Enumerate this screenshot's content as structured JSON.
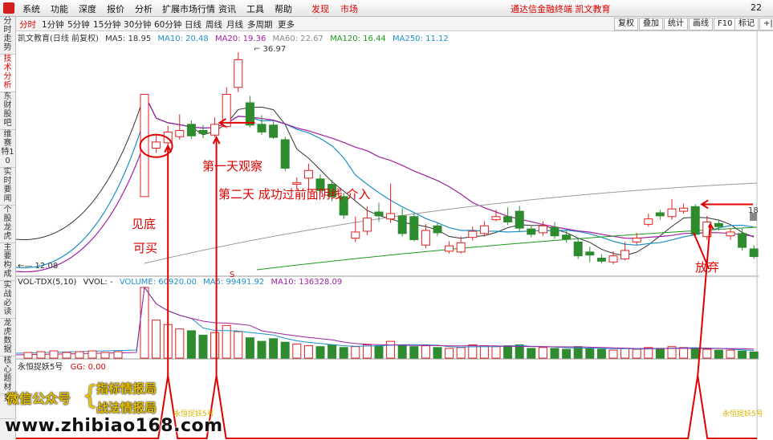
{
  "menu": {
    "items": [
      "系统",
      "功能",
      "深度",
      "报价",
      "分析",
      "扩展市场行情",
      "资讯",
      "工具",
      "帮助",
      "发现",
      "市场"
    ],
    "app_title": "通达信金融终端 凯文教育",
    "corner": "22"
  },
  "toolbar": {
    "periods": [
      "分时",
      "1分钟",
      "5分钟",
      "15分钟",
      "30分钟",
      "60分钟",
      "日线",
      "周线",
      "月线",
      "多周期",
      "更多"
    ],
    "buttons": [
      "复权",
      "叠加",
      "统计",
      "画线",
      "F10",
      "标记",
      "+|"
    ]
  },
  "sidebar": {
    "items": [
      "分时走势",
      "技术分析",
      "东财股吧",
      "维赛特10",
      "实时要闻",
      "个股龙虎",
      "主要构成",
      "实战必读",
      "龙虎数据",
      "核心题材",
      "第"
    ]
  },
  "price_legend": {
    "title": "凯文教育(日线 前复权)",
    "ma5": "MA5: 18.95",
    "ma10": "MA10: 20.48",
    "ma20": "MA20: 19.36",
    "ma60": "MA60: 22.67",
    "ma120": "MA120: 16.44",
    "ma250": "MA250: 11.12",
    "high_label": "36.97",
    "low_label": "12.08",
    "right_label": "18"
  },
  "volume_legend": {
    "name": "VOL-TDX(5,10)",
    "vvol": "VVOL: -",
    "volume": "VOLUME: 60920.00",
    "ma5": "MA5: 99491.92",
    "ma10": "MA10: 136328.09"
  },
  "indicator_legend": {
    "name": "永恒捉妖5号",
    "gg": "GG: 0.00",
    "tag": "永恒捉妖5号"
  },
  "annotations": {
    "a1": "见底",
    "a2": "可买",
    "a3": "第一天观察",
    "a4": "第二天 成功过前面阴线 介入",
    "a5": "放弃",
    "s_mark": "S"
  },
  "watermark": {
    "label": "微信公众号",
    "line1": "指标情报局",
    "line2": "战法情报局",
    "url": "www.zhibiao168.com"
  },
  "colors": {
    "up": "#e02020",
    "down": "#2e8b2e",
    "ma5": "#333333",
    "ma10": "#1e90c8",
    "ma20": "#a020a0",
    "ma60": "#888888",
    "ma120": "#1a9a1a",
    "ma250": "#e07020"
  },
  "chart_data": {
    "type": "candlestick",
    "candles": [
      {
        "o": 18.2,
        "c": 31.5,
        "h": 31.5,
        "l": 18.2,
        "v": 800
      },
      {
        "o": 24.5,
        "c": 25.3,
        "h": 26.4,
        "l": 23.9,
        "v": 430
      },
      {
        "o": 25.2,
        "c": 26.6,
        "h": 27.4,
        "l": 24.6,
        "v": 380
      },
      {
        "o": 26.0,
        "c": 26.8,
        "h": 28.9,
        "l": 25.6,
        "v": 330
      },
      {
        "o": 27.6,
        "c": 26.1,
        "h": 28.1,
        "l": 25.7,
        "v": 310
      },
      {
        "o": 26.8,
        "c": 26.4,
        "h": 27.5,
        "l": 25.8,
        "v": 260
      },
      {
        "o": 26.2,
        "c": 27.6,
        "h": 28.5,
        "l": 25.9,
        "v": 290
      },
      {
        "o": 27.3,
        "c": 31.5,
        "h": 32.4,
        "l": 27.1,
        "v": 370
      },
      {
        "o": 32.4,
        "c": 36.0,
        "h": 36.97,
        "l": 31.8,
        "v": 300
      },
      {
        "o": 30.4,
        "c": 27.5,
        "h": 31.3,
        "l": 27.2,
        "v": 230
      },
      {
        "o": 27.6,
        "c": 26.6,
        "h": 28.8,
        "l": 26.2,
        "v": 190
      },
      {
        "o": 27.5,
        "c": 25.9,
        "h": 28.0,
        "l": 25.7,
        "v": 220
      },
      {
        "o": 25.6,
        "c": 21.9,
        "h": 26.0,
        "l": 21.5,
        "v": 180
      },
      {
        "o": 19.8,
        "c": 20.0,
        "h": 20.7,
        "l": 19.1,
        "v": 160
      },
      {
        "o": 20.6,
        "c": 21.6,
        "h": 22.5,
        "l": 18.9,
        "v": 140
      },
      {
        "o": 20.5,
        "c": 19.0,
        "h": 21.1,
        "l": 18.6,
        "v": 130
      },
      {
        "o": 19.8,
        "c": 18.2,
        "h": 20.4,
        "l": 17.6,
        "v": 150
      },
      {
        "o": 18.2,
        "c": 15.8,
        "h": 18.7,
        "l": 15.3,
        "v": 120
      },
      {
        "o": 12.8,
        "c": 13.6,
        "h": 15.6,
        "l": 12.3,
        "v": 130
      },
      {
        "o": 13.7,
        "c": 15.4,
        "h": 16.9,
        "l": 13.2,
        "v": 150
      },
      {
        "o": 16.2,
        "c": 15.7,
        "h": 17.4,
        "l": 14.9,
        "v": 140
      },
      {
        "o": 15.3,
        "c": 16.0,
        "h": 19.9,
        "l": 14.8,
        "v": 190
      },
      {
        "o": 15.7,
        "c": 13.4,
        "h": 16.7,
        "l": 13.0,
        "v": 150
      },
      {
        "o": 15.6,
        "c": 12.6,
        "h": 16.0,
        "l": 12.4,
        "v": 130
      },
      {
        "o": 11.9,
        "c": 13.8,
        "h": 14.6,
        "l": 11.5,
        "v": 140
      },
      {
        "o": 14.4,
        "c": 13.5,
        "h": 14.8,
        "l": 13.1,
        "v": 120
      },
      {
        "o": 11.1,
        "c": 11.8,
        "h": 12.4,
        "l": 10.8,
        "v": 110
      },
      {
        "o": 11.0,
        "c": 12.2,
        "h": 13.0,
        "l": 10.8,
        "v": 120
      },
      {
        "o": 12.9,
        "c": 13.7,
        "h": 14.3,
        "l": 12.5,
        "v": 150
      },
      {
        "o": 13.4,
        "c": 14.4,
        "h": 15.0,
        "l": 13.0,
        "v": 140
      },
      {
        "o": 15.2,
        "c": 15.6,
        "h": 16.5,
        "l": 15.0,
        "v": 130
      },
      {
        "o": 15.6,
        "c": 14.9,
        "h": 16.8,
        "l": 14.5,
        "v": 140
      },
      {
        "o": 16.3,
        "c": 14.1,
        "h": 17.0,
        "l": 13.7,
        "v": 150
      },
      {
        "o": 14.0,
        "c": 13.3,
        "h": 14.5,
        "l": 12.9,
        "v": 110
      },
      {
        "o": 13.5,
        "c": 14.4,
        "h": 15.0,
        "l": 13.1,
        "v": 120
      },
      {
        "o": 14.2,
        "c": 13.1,
        "h": 14.9,
        "l": 12.7,
        "v": 110
      },
      {
        "o": 13.2,
        "c": 12.7,
        "h": 13.8,
        "l": 12.2,
        "v": 100
      },
      {
        "o": 12.3,
        "c": 10.5,
        "h": 12.8,
        "l": 10.1,
        "v": 130
      },
      {
        "o": 11.0,
        "c": 10.6,
        "h": 11.7,
        "l": 9.7,
        "v": 110
      },
      {
        "o": 10.2,
        "c": 9.8,
        "h": 10.7,
        "l": 9.5,
        "v": 100
      },
      {
        "o": 9.7,
        "c": 10.5,
        "h": 11.1,
        "l": 9.4,
        "v": 90
      },
      {
        "o": 10.1,
        "c": 11.2,
        "h": 12.3,
        "l": 9.9,
        "v": 110
      },
      {
        "o": 12.3,
        "c": 12.8,
        "h": 13.5,
        "l": 11.9,
        "v": 100
      },
      {
        "o": 14.6,
        "c": 15.3,
        "h": 16.0,
        "l": 14.3,
        "v": 120
      },
      {
        "o": 16.1,
        "c": 15.7,
        "h": 16.5,
        "l": 15.2,
        "v": 110
      },
      {
        "o": 15.6,
        "c": 16.6,
        "h": 17.9,
        "l": 15.2,
        "v": 130
      },
      {
        "o": 16.3,
        "c": 16.7,
        "h": 17.3,
        "l": 16.0,
        "v": 120
      },
      {
        "o": 16.9,
        "c": 13.3,
        "h": 17.2,
        "l": 13.0,
        "v": 110
      },
      {
        "o": 13.0,
        "c": 14.9,
        "h": 15.7,
        "l": 12.6,
        "v": 100
      },
      {
        "o": 14.7,
        "c": 14.3,
        "h": 15.2,
        "l": 13.8,
        "v": 90
      },
      {
        "o": 13.1,
        "c": 13.6,
        "h": 14.1,
        "l": 12.6,
        "v": 90
      },
      {
        "o": 13.4,
        "c": 11.6,
        "h": 14.1,
        "l": 11.2,
        "v": 80
      },
      {
        "o": 11.4,
        "c": 10.4,
        "h": 11.9,
        "l": 10.1,
        "v": 70
      }
    ],
    "ylim": [
      12.08,
      36.97
    ],
    "series_names": [
      "MA5",
      "MA10",
      "MA20",
      "MA60",
      "MA120",
      "MA250"
    ]
  }
}
